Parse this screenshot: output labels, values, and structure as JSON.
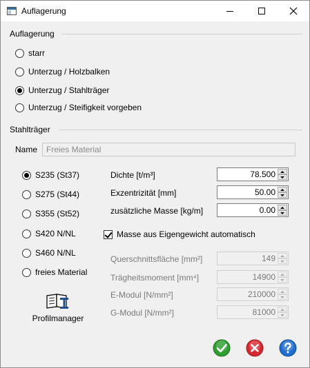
{
  "window": {
    "title": "Auflagerung"
  },
  "auflagerung": {
    "header": "Auflagerung",
    "options": [
      {
        "label": "starr",
        "checked": false
      },
      {
        "label": "Unterzug / Holzbalken",
        "checked": false
      },
      {
        "label": "Unterzug / Stahlträger",
        "checked": true
      },
      {
        "label": "Unterzug / Steifigkeit vorgeben",
        "checked": false
      }
    ]
  },
  "stahltraeger": {
    "header": "Stahlträger",
    "name_label": "Name",
    "name_value": "Freies Material",
    "materials": [
      {
        "label": "S235 (St37)",
        "checked": true
      },
      {
        "label": "S275 (St44)",
        "checked": false
      },
      {
        "label": "S355 (St52)",
        "checked": false
      },
      {
        "label": "S420 N/NL",
        "checked": false
      },
      {
        "label": "S460 N/NL",
        "checked": false
      },
      {
        "label": "freies Material",
        "checked": false
      }
    ],
    "fields": [
      {
        "label": "Dichte [t/m³]",
        "value": "78.500"
      },
      {
        "label": "Exzentrizität [mm]",
        "value": "50.00"
      },
      {
        "label": "zusätzliche Masse [kg/m]",
        "value": "0.00"
      }
    ],
    "checkbox": {
      "label": "Masse aus Eigengewicht automatisch",
      "checked": true
    },
    "disabled_fields": [
      {
        "label": "Querschnittsfläche [mm²]",
        "value": "149"
      },
      {
        "label": "Trägheitsmoment [mm⁴]",
        "value": "14900"
      },
      {
        "label": "E-Modul [N/mm²]",
        "value": "210000"
      },
      {
        "label": "G-Modul [N/mm²]",
        "value": "81000"
      }
    ],
    "profilmanager_label": "Profilmanager"
  },
  "buttons": {
    "ok_icon": "checkmark-icon",
    "cancel_icon": "cross-icon",
    "help_icon": "question-icon",
    "ok_color": "#2e9e2e",
    "cancel_color": "#d8282e",
    "help_color": "#1e6ecf"
  }
}
